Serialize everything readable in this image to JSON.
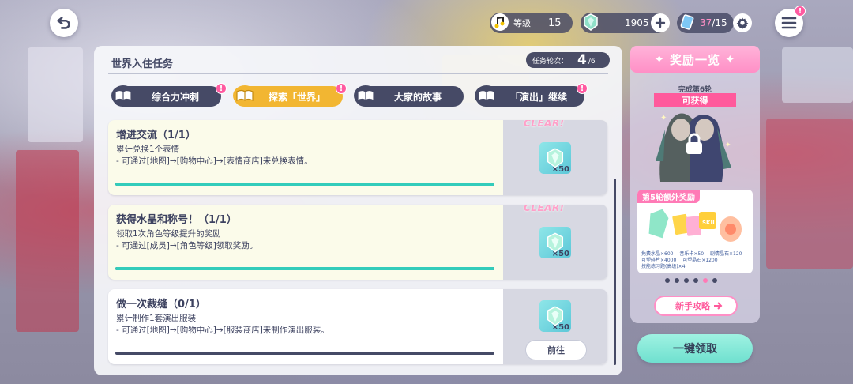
{
  "topbar": {
    "level_label": "等级",
    "level_value": "15",
    "crystal_value": "1905",
    "stamina_current": "37",
    "stamina_max": "/15"
  },
  "panel": {
    "title": "世界入住任务",
    "rounds_label": "任务轮次：",
    "rounds_current": "4",
    "rounds_total": "/6"
  },
  "tabs": [
    {
      "label": "综合力冲刺",
      "active": false,
      "alert": "!"
    },
    {
      "label": "探索「世界」",
      "active": true,
      "alert": "!"
    },
    {
      "label": "大家的故事",
      "active": false,
      "alert": ""
    },
    {
      "label": "「演出」继续",
      "active": false,
      "alert": "!"
    }
  ],
  "tasks": [
    {
      "name": "增进交流（1/1）",
      "desc": "累计兑换1个表情\n- 可通过[地图]→[购物中心]→[表情商店]来兑换表情。",
      "progress": 1.0,
      "status": "CLEAR!",
      "reward_qty": "×50"
    },
    {
      "name": "获得水晶和称号！（1/1）",
      "desc": "领取1次角色等级提升的奖励\n- 可通过[成员]→[角色等级]领取奖励。",
      "progress": 1.0,
      "status": "CLEAR!",
      "reward_qty": "×50"
    },
    {
      "name": "做一次裁缝（0/1）",
      "desc": "累计制作1套演出服装\n- 可通过[地图]→[购物中心]→[服装商店]来制作演出服装。",
      "progress": 0.0,
      "button": "前往",
      "reward_qty": "×50"
    }
  ],
  "reward": {
    "header": "奖励一览",
    "round_info": "完成第6轮",
    "ribbon": "可获得",
    "bonus_tag": "第5轮额外奖励",
    "bonus_lines": [
      "免费水晶×600",
      "音乐卡×50",
      "剧情晶石×120",
      "可塑碎片×4000",
      "可塑晶石×1200",
      "技能练习题(高级)×4"
    ],
    "page_count": 6,
    "page_active": 5,
    "guide_button": "新手攻略"
  },
  "claim_button": "一键领取",
  "colors": {
    "accent_teal": "#33ccbb",
    "accent_pink": "#ff7ab6",
    "tab_active": "#f2b632",
    "dark_navy": "#464a66"
  }
}
